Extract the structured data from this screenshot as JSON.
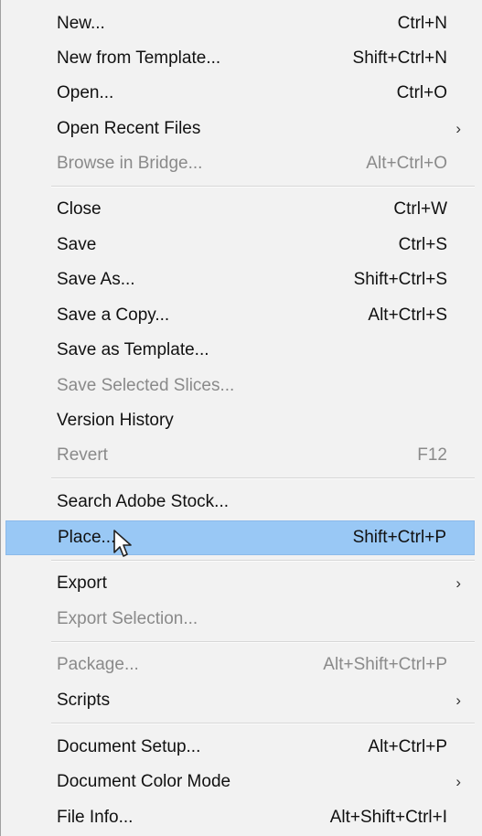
{
  "menu": {
    "items": [
      {
        "label": "New...",
        "shortcut": "Ctrl+N"
      },
      {
        "label": "New from Template...",
        "shortcut": "Shift+Ctrl+N"
      },
      {
        "label": "Open...",
        "shortcut": "Ctrl+O"
      },
      {
        "label": "Open Recent Files",
        "shortcut": "",
        "submenu": true
      },
      {
        "label": "Browse in Bridge...",
        "shortcut": "Alt+Ctrl+O",
        "disabled": true
      },
      {
        "label": "Close",
        "shortcut": "Ctrl+W"
      },
      {
        "label": "Save",
        "shortcut": "Ctrl+S"
      },
      {
        "label": "Save As...",
        "shortcut": "Shift+Ctrl+S"
      },
      {
        "label": "Save a Copy...",
        "shortcut": "Alt+Ctrl+S"
      },
      {
        "label": "Save as Template...",
        "shortcut": ""
      },
      {
        "label": "Save Selected Slices...",
        "shortcut": "",
        "disabled": true
      },
      {
        "label": "Version History",
        "shortcut": ""
      },
      {
        "label": "Revert",
        "shortcut": "F12",
        "disabled": true
      },
      {
        "label": "Search Adobe Stock...",
        "shortcut": ""
      },
      {
        "label": "Place...",
        "shortcut": "Shift+Ctrl+P",
        "highlighted": true
      },
      {
        "label": "Export",
        "shortcut": "",
        "submenu": true
      },
      {
        "label": "Export Selection...",
        "shortcut": "",
        "disabled": true
      },
      {
        "label": "Package...",
        "shortcut": "Alt+Shift+Ctrl+P",
        "disabled": true
      },
      {
        "label": "Scripts",
        "shortcut": "",
        "submenu": true
      },
      {
        "label": "Document Setup...",
        "shortcut": "Alt+Ctrl+P"
      },
      {
        "label": "Document Color Mode",
        "shortcut": "",
        "submenu": true
      },
      {
        "label": "File Info...",
        "shortcut": "Alt+Shift+Ctrl+I"
      }
    ],
    "submenu_arrow": "›",
    "colors": {
      "highlight": "#99c8f5",
      "disabled_text": "#8a8a8a",
      "text": "#111111"
    }
  }
}
